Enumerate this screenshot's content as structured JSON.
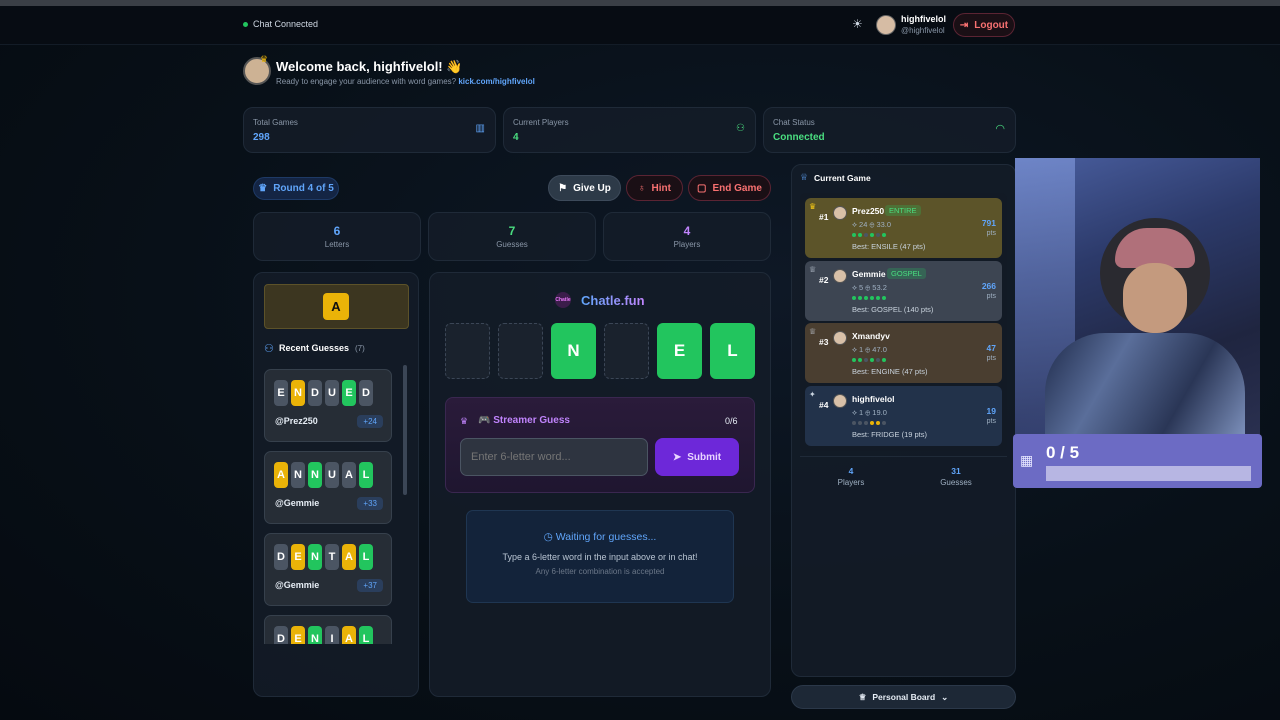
{
  "header": {
    "chat_status": "Chat Connected",
    "username": "highfivelol",
    "handle": "@highfivelol",
    "logout_label": "Logout"
  },
  "welcome": {
    "title": "Welcome back, highfivelol! 👋",
    "subtitle": "Ready to engage your audience with word games?",
    "link": "kick.com/highfivelol"
  },
  "stats": [
    {
      "label": "Total Games",
      "value": "298"
    },
    {
      "label": "Current Players",
      "value": "4"
    },
    {
      "label": "Chat Status",
      "value": "Connected"
    }
  ],
  "controls": {
    "round": "Round 4 of 5",
    "give_up": "Give Up",
    "hint": "Hint",
    "end_game": "End Game"
  },
  "game_stats": [
    {
      "value": "6",
      "label": "Letters",
      "color": "#60a5fa"
    },
    {
      "value": "7",
      "label": "Guesses",
      "color": "#4ade80"
    },
    {
      "value": "4",
      "label": "Players",
      "color": "#c084fc"
    }
  ],
  "hint_letter": "A",
  "recent": {
    "title": "Recent Guesses",
    "count": "(7)",
    "items": [
      {
        "letters": [
          "E",
          "N",
          "D",
          "U",
          "E",
          "D"
        ],
        "states": [
          "x",
          "y",
          "x",
          "x",
          "g",
          "x"
        ],
        "user": "@Prez250",
        "score": "+24"
      },
      {
        "letters": [
          "A",
          "N",
          "N",
          "U",
          "A",
          "L"
        ],
        "states": [
          "y",
          "x",
          "g",
          "x",
          "x",
          "g"
        ],
        "user": "@Gemmie",
        "score": "+33"
      },
      {
        "letters": [
          "D",
          "E",
          "N",
          "T",
          "A",
          "L"
        ],
        "states": [
          "x",
          "y",
          "g",
          "x",
          "y",
          "g"
        ],
        "user": "@Gemmie",
        "score": "+37"
      },
      {
        "letters": [
          "D",
          "E",
          "N",
          "I",
          "A",
          "L"
        ],
        "states": [
          "x",
          "y",
          "g",
          "x",
          "y",
          "g"
        ],
        "user": "",
        "score": ""
      }
    ]
  },
  "brand": "Chatle.fun",
  "board": {
    "letters": [
      "",
      "",
      "N",
      "",
      "E",
      "L"
    ],
    "states": [
      "empty",
      "empty",
      "g",
      "empty",
      "g",
      "g"
    ]
  },
  "streamer": {
    "title": "🎮 Streamer Guess",
    "count": "0/6",
    "placeholder": "Enter 6-letter word...",
    "submit": "Submit"
  },
  "waiting": {
    "title": "Waiting for guesses...",
    "line1": "Type a 6-letter word in the input above or in chat!",
    "line2": "Any 6-letter combination is accepted"
  },
  "leaderboard": {
    "title": "Current Game",
    "players": [
      {
        "rank": "#1",
        "name": "Prez250",
        "tag": "ENTIRE",
        "stats": "⟡ 24 ⊕ 33.0",
        "best": "Best: ENSILE (47 pts)",
        "pts": "791",
        "bg": "#5c5429",
        "dots": [
          "g",
          "g",
          "x",
          "g",
          "x",
          "g"
        ]
      },
      {
        "rank": "#2",
        "name": "Gemmie",
        "tag": "GOSPEL",
        "stats": "⟡ 5 ⊕ 53.2",
        "best": "Best: GOSPEL (140 pts)",
        "pts": "266",
        "bg": "#3d4552",
        "dots": [
          "g",
          "g",
          "g",
          "g",
          "g",
          "g"
        ]
      },
      {
        "rank": "#3",
        "name": "Xmandyv",
        "tag": "",
        "stats": "⟡ 1 ⊕ 47.0",
        "best": "Best: ENGINE (47 pts)",
        "pts": "47",
        "bg": "#4a3e30",
        "dots": [
          "g",
          "g",
          "x",
          "g",
          "x",
          "g"
        ]
      },
      {
        "rank": "#4",
        "name": "highfivelol",
        "tag": "",
        "stats": "⟡ 1 ⊕ 19.0",
        "best": "Best: FRIDGE (19 pts)",
        "pts": "19",
        "bg": "#22324a",
        "dots": [
          "x",
          "x",
          "x",
          "y",
          "y",
          "x"
        ]
      }
    ],
    "pts_label": "pts",
    "footer_players": "4",
    "footer_players_label": "Players",
    "footer_guesses": "31",
    "footer_guesses_label": "Guesses",
    "personal_board": "Personal Board"
  },
  "overlay": {
    "progress": "0 / 5",
    "progress_fraction": 0
  }
}
